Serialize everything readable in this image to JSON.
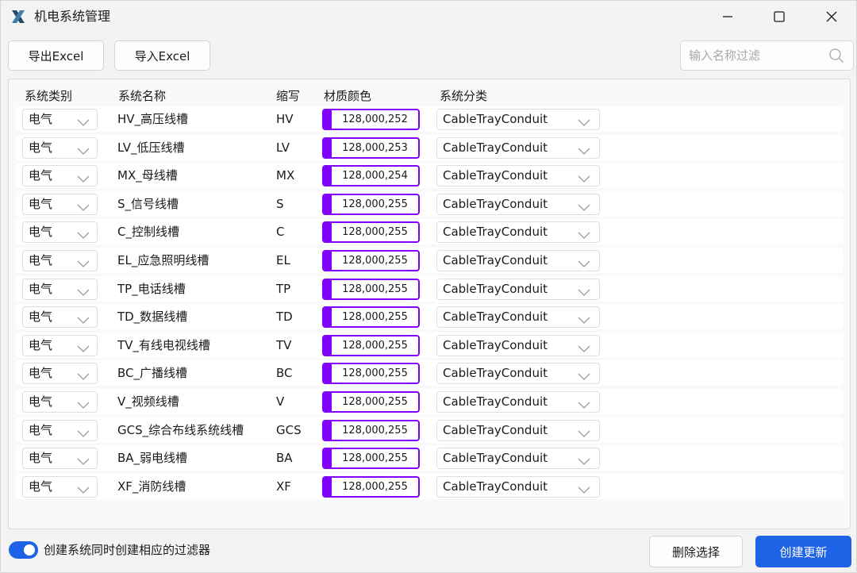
{
  "window": {
    "title": "机电系统管理"
  },
  "toolbar": {
    "export_label": "导出Excel",
    "import_label": "导入Excel",
    "search_placeholder": "输入名称过滤"
  },
  "table": {
    "headers": {
      "category": "系统类别",
      "name": "系统名称",
      "abbr": "缩写",
      "color": "材质颜色",
      "classification": "系统分类"
    },
    "rows": [
      {
        "category": "电气",
        "name": "HV_高压线槽",
        "abbr": "HV",
        "color": "128,000,252",
        "classification": "CableTrayConduit"
      },
      {
        "category": "电气",
        "name": "LV_低压线槽",
        "abbr": "LV",
        "color": "128,000,253",
        "classification": "CableTrayConduit"
      },
      {
        "category": "电气",
        "name": "MX_母线槽",
        "abbr": "MX",
        "color": "128,000,254",
        "classification": "CableTrayConduit"
      },
      {
        "category": "电气",
        "name": "S_信号线槽",
        "abbr": "S",
        "color": "128,000,255",
        "classification": "CableTrayConduit"
      },
      {
        "category": "电气",
        "name": "C_控制线槽",
        "abbr": "C",
        "color": "128,000,255",
        "classification": "CableTrayConduit"
      },
      {
        "category": "电气",
        "name": "EL_应急照明线槽",
        "abbr": "EL",
        "color": "128,000,255",
        "classification": "CableTrayConduit"
      },
      {
        "category": "电气",
        "name": "TP_电话线槽",
        "abbr": "TP",
        "color": "128,000,255",
        "classification": "CableTrayConduit"
      },
      {
        "category": "电气",
        "name": "TD_数据线槽",
        "abbr": "TD",
        "color": "128,000,255",
        "classification": "CableTrayConduit"
      },
      {
        "category": "电气",
        "name": "TV_有线电视线槽",
        "abbr": "TV",
        "color": "128,000,255",
        "classification": "CableTrayConduit"
      },
      {
        "category": "电气",
        "name": "BC_广播线槽",
        "abbr": "BC",
        "color": "128,000,255",
        "classification": "CableTrayConduit"
      },
      {
        "category": "电气",
        "name": "V_视频线槽",
        "abbr": "V",
        "color": "128,000,255",
        "classification": "CableTrayConduit"
      },
      {
        "category": "电气",
        "name": "GCS_综合布线系统线槽",
        "abbr": "GCS",
        "color": "128,000,255",
        "classification": "CableTrayConduit"
      },
      {
        "category": "电气",
        "name": "BA_弱电线槽",
        "abbr": "BA",
        "color": "128,000,255",
        "classification": "CableTrayConduit"
      },
      {
        "category": "电气",
        "name": "XF_消防线槽",
        "abbr": "XF",
        "color": "128,000,255",
        "classification": "CableTrayConduit"
      }
    ]
  },
  "footer": {
    "toggle_label": "创建系统同时创建相应的过滤器",
    "toggle_on": true,
    "delete_label": "删除选择",
    "create_label": "创建更新"
  },
  "colors": {
    "accent": "#1e63e6",
    "swatch": "#8000fc"
  }
}
